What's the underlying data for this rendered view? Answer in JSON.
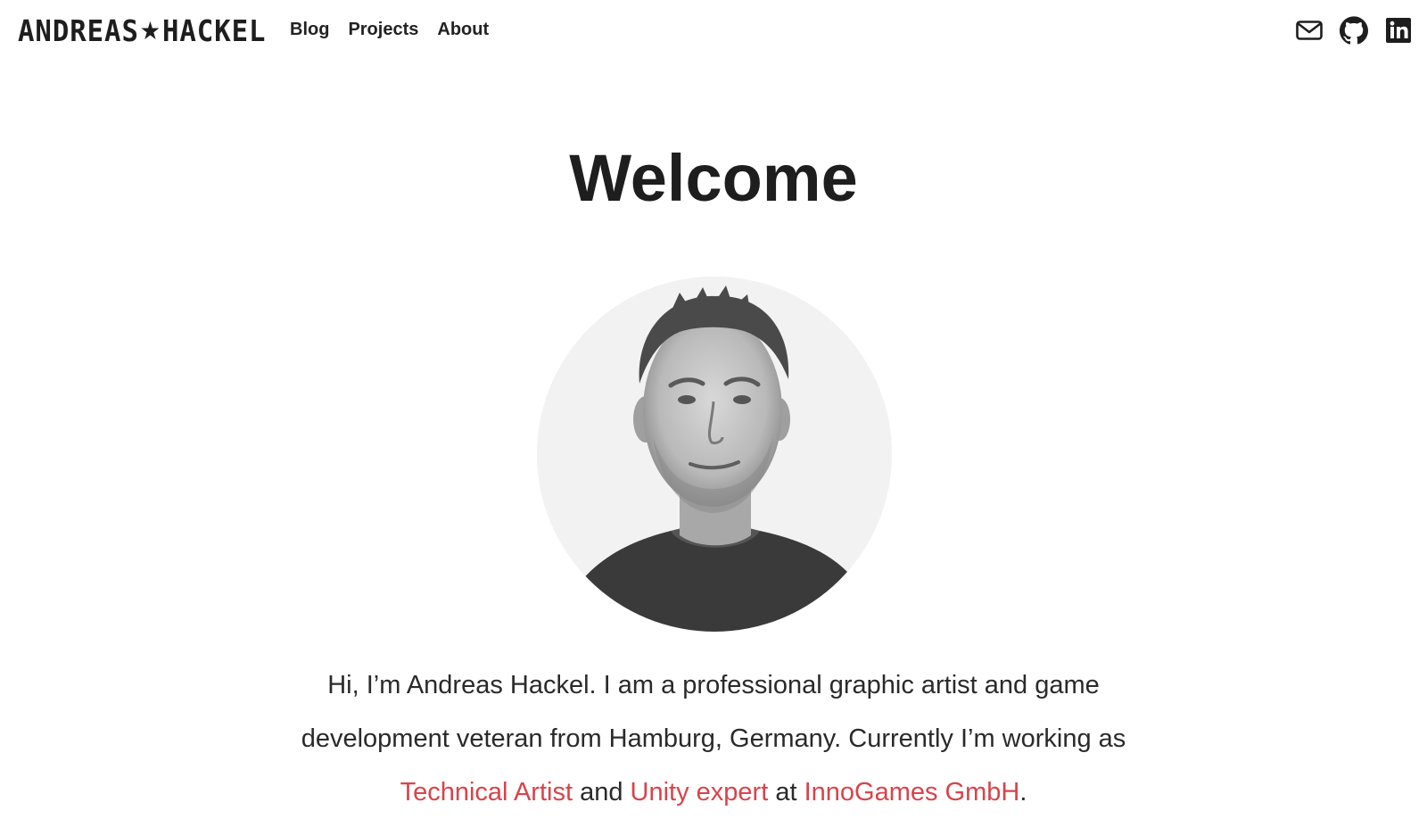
{
  "header": {
    "logo_left": "ANDREAS",
    "logo_star": "★",
    "logo_right": "HACKEL",
    "nav": [
      {
        "label": "Blog"
      },
      {
        "label": "Projects"
      },
      {
        "label": "About"
      }
    ],
    "social": [
      {
        "icon": "mail-icon"
      },
      {
        "icon": "github-icon"
      },
      {
        "icon": "linkedin-icon"
      }
    ]
  },
  "main": {
    "title": "Welcome",
    "intro": {
      "line1": "Hi, I’m Andreas Hackel. I am a professional graphic artist and game development veteran from Hamburg, Germany. Currently I’m working as",
      "link1": "Technical Artist",
      "and_text": "and",
      "link2": "Unity expert",
      "at_text": "at",
      "link3": "InnoGames GmbH",
      "end": "."
    }
  },
  "colors": {
    "link": "#d9434a",
    "text": "#222222",
    "background": "#ffffff"
  }
}
